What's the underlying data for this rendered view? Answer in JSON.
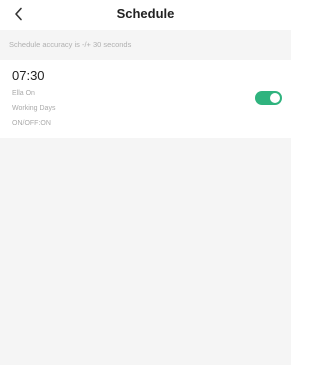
{
  "header": {
    "title": "Schedule",
    "back_icon": "chevron-left-icon"
  },
  "info": {
    "accuracy_text": "Schedule accuracy is -/+ 30 seconds"
  },
  "schedules": [
    {
      "time": "07:30",
      "action": "Ella On",
      "repeat": "Working Days",
      "status": "ON/OFF:ON",
      "enabled": true
    }
  ],
  "colors": {
    "toggle_on": "#2fb37e",
    "background": "#f5f5f5"
  }
}
